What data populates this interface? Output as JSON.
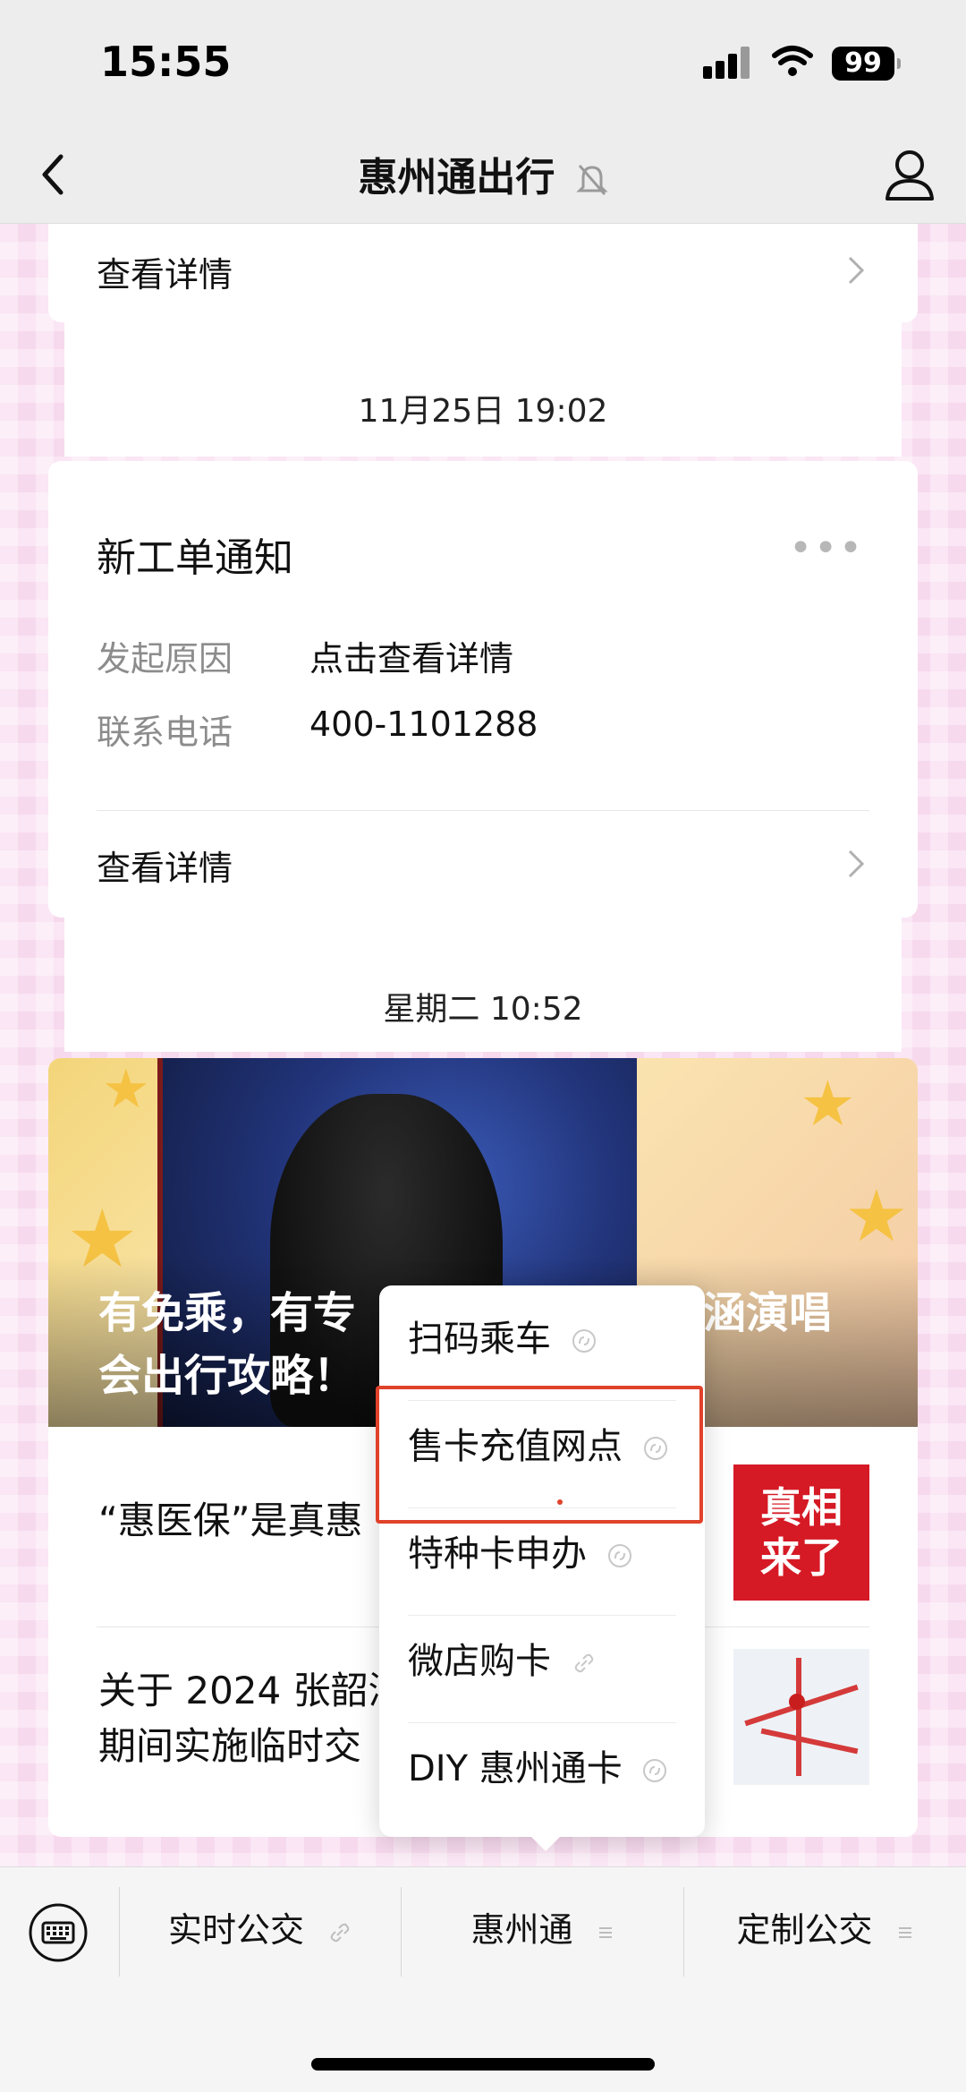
{
  "status_bar": {
    "time": "15:55",
    "battery": "99"
  },
  "nav": {
    "title": "惠州通出行"
  },
  "top_card": {
    "detail_label": "查看详情"
  },
  "timestamps": {
    "first": "11月25日 19:02",
    "second": "星期二 10:52"
  },
  "work_order": {
    "title": "新工单通知",
    "fields": [
      {
        "label": "发起原因",
        "value": "点击查看详情"
      },
      {
        "label": "联系电话",
        "value": "400-1101288"
      }
    ],
    "detail_label": "查看详情"
  },
  "article": {
    "banner_line1": "有免乘，有专",
    "banner_line1_right": "韶涵演唱",
    "banner_line2": "会出行攻略！",
    "items": [
      {
        "text": "“惠医保”是真惠",
        "thumb_text_1": "真相",
        "thumb_text_2": "来了"
      },
      {
        "text_line1": "关于 2024 张韶涵",
        "text_line2": "期间实施临时交"
      }
    ]
  },
  "popup_menu": {
    "items": [
      {
        "label": "扫码乘车"
      },
      {
        "label": "售卡充值网点"
      },
      {
        "label": "特种卡申办"
      },
      {
        "label": "微店购卡"
      },
      {
        "label": "DIY 惠州通卡"
      }
    ]
  },
  "bottom_menu": {
    "tabs": [
      {
        "label": "实时公交"
      },
      {
        "label": "惠州通"
      },
      {
        "label": "定制公交"
      }
    ]
  },
  "colors": {
    "highlight": "#e0422a",
    "background_pink": "#f7d9ee",
    "bar_gray": "#ededed"
  }
}
